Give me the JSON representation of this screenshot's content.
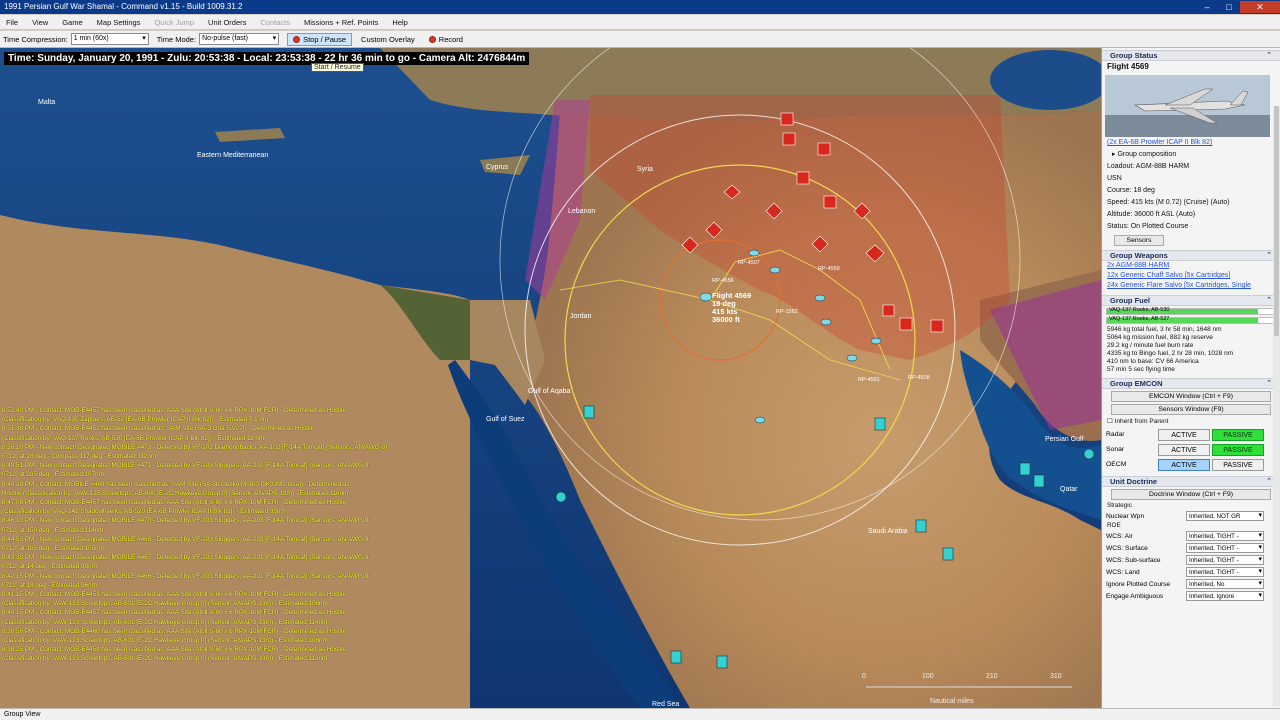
{
  "window": {
    "title": "1991 Persian Gulf War Shamal - Command v1.15 - Build 1009.31.2"
  },
  "menu": [
    {
      "label": "File",
      "disabled": false
    },
    {
      "label": "View",
      "disabled": false
    },
    {
      "label": "Game",
      "disabled": false
    },
    {
      "label": "Map Settings",
      "disabled": false
    },
    {
      "label": "Quick Jump",
      "disabled": true
    },
    {
      "label": "Unit Orders",
      "disabled": false
    },
    {
      "label": "Contacts",
      "disabled": true
    },
    {
      "label": "Missions + Ref. Points",
      "disabled": false
    },
    {
      "label": "Help",
      "disabled": false
    }
  ],
  "toolbar": {
    "time_compression_label": "Time Compression:",
    "time_compression_value": "1 min (60x)",
    "time_mode_label": "Time Mode:",
    "time_mode_value": "No-pulse (fast)",
    "stop_label": "Stop / Pause",
    "custom_overlay_label": "Custom Overlay",
    "record_label": "Record"
  },
  "tooltip": "Start / Resume",
  "status_line": "Time: Sunday, January 20, 1991 - Zulu: 20:53:38 - Local: 23:53:38 - 22 hr 36 min to go - Camera Alt: 2476844m",
  "map_labels": {
    "malta": "Malta",
    "eastern_med": "Eastern Mediterranean",
    "cyprus": "Cyprus",
    "syria": "Syria",
    "lebanon": "Lebanon",
    "jordan": "Jordan",
    "gulf_aqaba": "Gulf of Aqaba",
    "gulf_suez": "Gulf of Suez",
    "persian_gulf": "Persian Gulf",
    "qatar": "Qatar",
    "saudi_arabia": "Saudi Arabia",
    "red_sea": "Red Sea"
  },
  "flight_label": {
    "name": "Flight 4569",
    "course": "18 deg",
    "speed": "415 kts",
    "alt": "36000 ft"
  },
  "rp_labels": [
    "RP-4507",
    "RP-4559",
    "RP-4556",
    "RP-1562",
    "RP-4501",
    "RP-4508"
  ],
  "scale": {
    "ticks": [
      "0",
      "100",
      "210",
      "310"
    ],
    "unit": "Nautical miles"
  },
  "log_messages": [
    "8:52:49 PM - Contact: MOB-E4457 has been classified as: AAA Site (Atoll S-60 x 6 RPX-10M FCR) - Determined as Hostile",
    "(Classification by: VAQ-130 Zappers, AB-52 [EA-6B Prowler ICAP II Blk 82]) - Estimated 7.1 nm",
    "8:51:38 PM - Contact: MOB-E4452 has been classified as: SAM Site (SA-3 Goa [5V27]) - Determined as Hostile",
    "(Classification by: VAQ-137 Rooks, AB-530 [EA-6B Prowler ICAP II Blk 82]) - Estimated 11 nm",
    "8:50:10 PM - New contact! Designated MOBILE #473 - Detected by VF-102 Diamondbacks, AA-102 [F-14A Tomcat] (Sensors: AN/AWG-9)",
    "0712] at 28 deg - Compass 117 deg - Estimated 112nm",
    "8:49:51 PM - New contact! Designated MOBILE #471 - Detected by VF-103 Sluggers, AA-202 [F-14A Tomcat] (Sensors: AN/AWG-9",
    "0712] at 285 deg - Estimated 107nm",
    "8:48:28 PM - Contact: MOBILE #469 has been classified as: SAM Site (SA-8b Gecko Mod-0 [9K33M2 Osa]) - Determined as",
    "Hostile (Classification by: VAW-125 Screwtops, AB-600 [E-2C Hawkeye Group 0] (Sensor: AN/APS-138)) - Estimated 116nm",
    "8:47:08 PM - Contact: MOB-E4457 has been classified as: AAA Site (Atoll S-60 x 6 RPX-10M FCR) - Determined as Hostile",
    "(Classification by: VAQ-141 Shadowhawks, AB-520 [EA-6B Prowler ICAP II Blk 82]) - Estimated 95nm",
    "8:46:10 PM - New contact! Designated MOBILE #470 - Detected by VF-103 Sluggers, AA-203 [F-14A Tomcat] (Sensors: AN/AWG-9",
    "0712] at 150 deg - Estimated 114nm",
    "8:44:53 PM - New contact! Designated MOBILE #468 - Detected by VF-103 Sluggers, AA-202 [F-14A Tomcat] (Sensors: AN/AWG-9",
    "0712] at 185 deg - Estimated 105nm",
    "8:43:38 PM - New contact! Designated MOBILE #467 - Detected by VF-103 Sluggers, AA-201 [F-14A Tomcat] (Sensors: AN/AWG-9",
    "0712] at 14 deg - Estimated 99nm",
    "8:42:15 PM - New contact! Designated MOBILE #466 - Detected by VF-103 Sluggers, AA-201 [F-14A Tomcat] (Sensors: AN/AWG-9",
    "0712] at 18 deg - Estimated 96nm",
    "8:41:15 PM - Contact: MOB-E4453 has been classified as: AAA Site (Atoll S-60 x 6 RPX-10M FCR) - Determined as Hostile",
    "(Classification by: VAW-123 Screwtops, AB-601 [E-2C Hawkeye Group 0] (Sensor: AN/APS-138)) - Estimated 106nm",
    "8:40:15 PM - Contact: MOB-E4457 has been classified as: AAA Site (Atoll S-60 x 6 RPX-10M FCR) - Determined as Hostile",
    "(Classification by: VAW-123 Screwtops, AB-601 [E-2C Hawkeye Group 0] (Sensor: AN/APS-138)) - Estimated 114nm",
    "8:38:56 PM - Contact: MOB-E4460 has been classified as: AAA Site (Atoll S-60 x 6 RPX-10M FCR) - Determined as Hostile",
    "(Classification by: VAW-123 Screwtops, AB-601 [E-2C Hawkeye Group 0] (Sensor: AN/APS-138)) - Estimated 108nm",
    "8:38:25 PM - Contact: MOB-E4458 has been classified as: AAA Site (Atoll S-60 x 6 RPX-10M FCR) - Determined as Hostile",
    "(Classification by: VAW-123 Screwtops, AB-601 [E-2C Hawkeye Group 0] (Sensor: AN/APS-138)) - Estimated 113nm"
  ],
  "status_bar": "Group View",
  "panel": {
    "group_status_header": "Group Status",
    "flight_name": "Flight 4569",
    "aircraft_link": "(2x EA-6B Prowler ICAP II Blk 82)",
    "group_composition": "Group composition",
    "loadout": "Loadout: AGM-88B HARM",
    "side": "USN",
    "course": "Course: 18 deg",
    "speed": "Speed: 415 kts (M 0.72) (Cruise)   (Auto)",
    "altitude": "Altitude: 36000 ft ASL   (Auto)",
    "status": "Status: On Plotted Course",
    "sensors_btn": "Sensors",
    "weapons_header": "Group Weapons",
    "weapons": [
      "2x AGM-88B HARM",
      "12x Generic Chaff Salvo [5x Cartridges]",
      "24x Generic Flare Salvo [5x Cartridges, Single"
    ],
    "fuel_header": "Group Fuel",
    "fuel_bars": [
      {
        "name": "VAQ-137 Rooks, AB-530",
        "level": 0.9
      },
      {
        "name": "VAQ-137 Rooks, AB-527",
        "level": 0.9
      }
    ],
    "fuel_lines": [
      "5946 kg total fuel, 3 hr 58 min, 1648 nm",
      "5064 kg mission fuel, 882 kg reserve",
      "29.2 kg / minute fuel burn rate",
      "4335 kg to Bingo fuel, 2 hr 28 min, 1028 nm",
      "410 nm to base: CV 66 America",
      "57 min 5 sec flying time"
    ],
    "emcon_header": "Group EMCON",
    "emcon_window_btn": "EMCON Window (Ctrl + F9)",
    "sensors_window_btn": "Sensors Window (F9)",
    "inherit_label": "Inherit from Parent",
    "emcon_rows": [
      {
        "name": "Radar",
        "active": "ACTIVE",
        "passive": "PASSIVE",
        "selected": "passive"
      },
      {
        "name": "Sonar",
        "active": "ACTIVE",
        "passive": "PASSIVE",
        "selected": "passive"
      },
      {
        "name": "OECM",
        "active": "ACTIVE",
        "passive": "PASSIVE",
        "selected": "active"
      }
    ],
    "doctrine_header": "Unit Doctrine",
    "doctrine_window_btn": "Doctrine Window (Ctrl + F9)",
    "strategic_label": "Strategic",
    "nuclear_label": "Nuclear Wpn",
    "nuclear_value": "Inherited, NOT GR",
    "roe_label": "ROE",
    "doctrine_rows": [
      {
        "name": "WCS: Air",
        "value": "Inherited, TIGHT -"
      },
      {
        "name": "WCS: Surface",
        "value": "Inherited, TIGHT -"
      },
      {
        "name": "WCS: Sub-surface",
        "value": "Inherited, TIGHT -"
      },
      {
        "name": "WCS: Land",
        "value": "Inherited, TIGHT -"
      },
      {
        "name": "Ignore Plotted Course",
        "value": "Inherited, No"
      },
      {
        "name": "Engage Ambiguous",
        "value": "Inherited, Ignore"
      }
    ]
  }
}
